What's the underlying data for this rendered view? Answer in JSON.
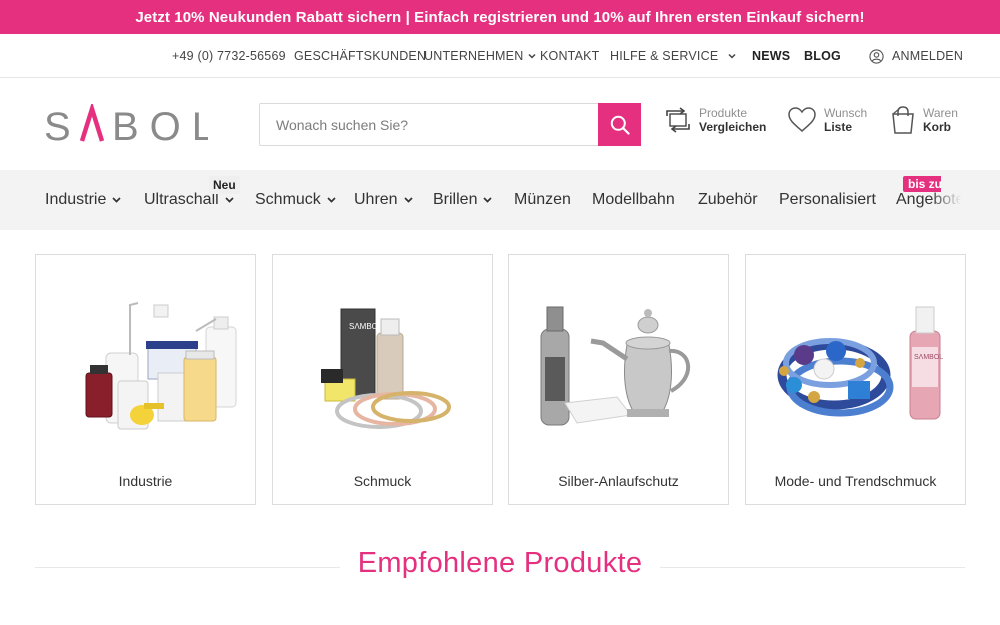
{
  "promo": {
    "text": "Jetzt 10% Neukunden Rabatt sichern | Einfach registrieren und 10% auf Ihren ersten Einkauf sichern!"
  },
  "servicebar": {
    "phone": "+49 (0) 7732-56569",
    "business": "GESCHÄFTSKUNDEN",
    "company": "UNTERNEHMEN",
    "contact": "KONTAKT",
    "help": "HILFE & SERVICE",
    "news": "NEWS",
    "blog": "BLOG",
    "login": "ANMELDEN"
  },
  "header": {
    "logo": "SΛMBOL",
    "search_placeholder": "Wonach suchen Sie?",
    "compare": {
      "small": "Produkte",
      "big": "Vergleichen"
    },
    "wishlist": {
      "small": "Wunsch",
      "big": "Liste"
    },
    "cart": {
      "small": "Waren",
      "big": "Korb"
    }
  },
  "nav": {
    "items": [
      {
        "label": "Industrie"
      },
      {
        "label": "Ultraschall"
      },
      {
        "label": "Schmuck"
      },
      {
        "label": "Uhren"
      },
      {
        "label": "Brillen"
      },
      {
        "label": "Münzen"
      },
      {
        "label": "Modellbahn"
      },
      {
        "label": "Zubehör"
      },
      {
        "label": "Personalisiert"
      },
      {
        "label": "Angebote"
      }
    ],
    "badge_new": "Neu",
    "badge_offer": "bis zu"
  },
  "categories": [
    {
      "label": "Industrie"
    },
    {
      "label": "Schmuck"
    },
    {
      "label": "Silber-Anlaufschutz"
    },
    {
      "label": "Mode- und Trendschmuck"
    }
  ],
  "section": {
    "title": "Empfohlene Produkte"
  },
  "colors": {
    "accent": "#e5307f",
    "nav_bg": "#f3f3f4"
  }
}
